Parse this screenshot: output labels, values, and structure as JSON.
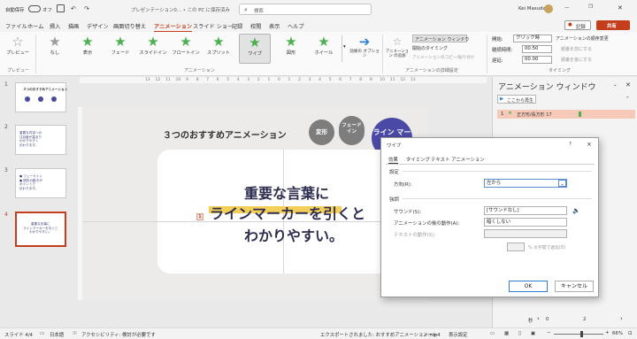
{
  "titlebar": {
    "autosave": "自動保存",
    "autosave_state": "オフ",
    "file_name": "プレゼンテーション0... • この PC に保存済み",
    "search_placeholder": "検索",
    "user_name": "Kei Masuda",
    "record_button": "記録",
    "share_button": "共有"
  },
  "tabs": [
    "ファイル",
    "ホーム",
    "挿入",
    "描画",
    "デザイン",
    "画面切り替え",
    "アニメーション",
    "スライド ショー",
    "記録",
    "校閲",
    "表示",
    "ヘルプ"
  ],
  "ribbon": {
    "preview": "プレビュー",
    "preview_group": "プレビュー",
    "animations": [
      {
        "label": "なし",
        "icon": "star-none-icon"
      },
      {
        "label": "表示",
        "icon": "star-icon"
      },
      {
        "label": "フェード",
        "icon": "star-icon"
      },
      {
        "label": "スライドイン",
        "icon": "star-icon"
      },
      {
        "label": "フロートイン",
        "icon": "star-icon"
      },
      {
        "label": "スプリット",
        "icon": "star-icon"
      },
      {
        "label": "ワイプ",
        "icon": "star-icon"
      },
      {
        "label": "図形",
        "icon": "star-icon"
      },
      {
        "label": "ホイール",
        "icon": "star-icon"
      }
    ],
    "effect_options": "効果の オプション",
    "animation_group": "アニメーション",
    "add_animation": "アニメーション の追加",
    "animation_pane": "アニメーション ウィンドウ",
    "trigger": "開始のタイミング",
    "painter": "アニメーションのコピー/貼り付け",
    "advanced_group": "アニメーションの詳細設定",
    "start_label": "開始:",
    "start_value": "クリック時",
    "duration_label": "継続時間:",
    "duration_value": "00.50",
    "delay_label": "遅延:",
    "delay_value": "00.00",
    "reorder_title": "アニメーションの順序変更",
    "move_earlier": "順番を前にする",
    "move_later": "順番を後にする",
    "timing_group": "タイミング"
  },
  "ruler_ticks": [
    "13",
    "12",
    "11",
    "10",
    "9",
    "8",
    "7",
    "6",
    "5",
    "4",
    "3",
    "2",
    "1",
    "0",
    "1",
    "2",
    "3",
    "4",
    "5",
    "6",
    "7",
    "8",
    "9",
    "10",
    "11",
    "12",
    "13"
  ],
  "thumbnails": [
    {
      "num": "1",
      "title": "３つのおすすめアニメーション",
      "lines": []
    },
    {
      "num": "2",
      "title": "",
      "lines": [
        "重要な内容への",
        "注目度が高まり",
        "わかりやすく",
        "伝わります。"
      ]
    },
    {
      "num": "3",
      "title": "",
      "lines": [
        "● フェードイン",
        "● 図形の動きが",
        "ポイントで",
        "伝わります。"
      ]
    },
    {
      "num": "4",
      "title": "",
      "lines": [
        "重要な言葉に",
        "ラインマーカーを引くと",
        "わかりやすい。"
      ]
    }
  ],
  "slide": {
    "title": "３つのおすすめアニメーション",
    "bubble1": "変形",
    "bubble2": "フェード イン",
    "bubble3": "ライン マー",
    "line1": "重要な言葉に",
    "line2": "ラインマーカーを引くと",
    "line3": "わかりやすい。",
    "marker_badge": "1"
  },
  "pane": {
    "title": "アニメーション ウィンドウ",
    "play_button": "ここから再生",
    "item_num": "1",
    "item_label": "正方形/長方形 17",
    "zoom_label": "秒"
  },
  "dialog": {
    "title": "ワイプ",
    "help": "?",
    "close": "×",
    "tabs": [
      "効果",
      "タイミング",
      "テキスト アニメーション"
    ],
    "section_settings": "設定",
    "direction_label": "方向(R):",
    "direction_value": "左から",
    "section_emphasis": "強調",
    "sound_label": "サウンド(S):",
    "sound_value": "[サウンドなし]",
    "after_label": "アニメーションの後の動作(A):",
    "after_value": "暗くしない",
    "text_label": "テキストの動作(X):",
    "text_value": "",
    "percent_label": "% 文字間で遅延(D)",
    "ok": "OK",
    "cancel": "キャンセル"
  },
  "status": {
    "slide": "スライド 4/4",
    "language": "日本語",
    "accessibility": "アクセシビリティ: 検討が必要です",
    "export": "エクスポートされました: おすすめアニメーション.mp4",
    "notes": "ノート",
    "display": "表示設定",
    "zoom": "66%"
  }
}
